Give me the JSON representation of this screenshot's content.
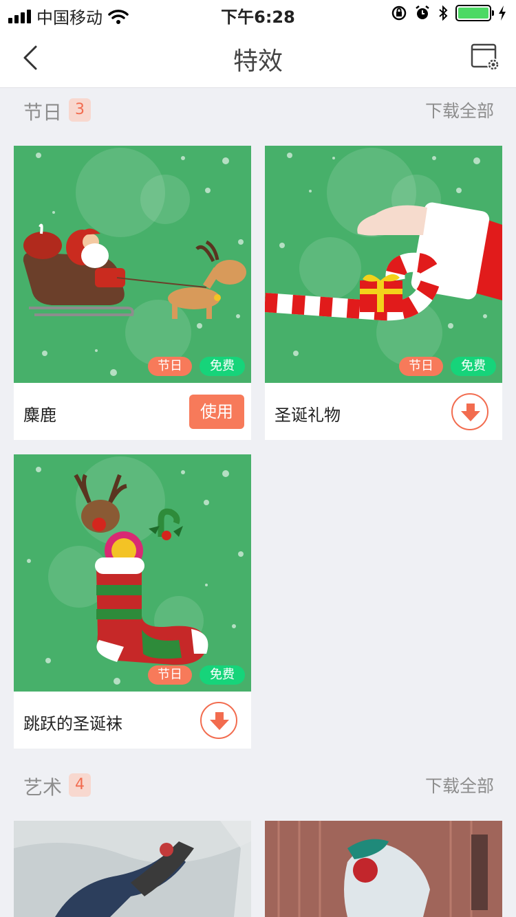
{
  "status_bar": {
    "carrier": "中国移动",
    "time": "下午6:28"
  },
  "nav": {
    "title": "特效"
  },
  "sections": [
    {
      "name": "节日",
      "count": "3",
      "download_all": "下载全部",
      "items": [
        {
          "name": "麋鹿",
          "tag1": "节日",
          "tag2": "免费",
          "action": "使用"
        },
        {
          "name": "圣诞礼物",
          "tag1": "节日",
          "tag2": "免费"
        },
        {
          "name": "跳跃的圣诞袜",
          "tag1": "节日",
          "tag2": "免费"
        }
      ]
    },
    {
      "name": "艺术",
      "count": "4",
      "download_all": "下载全部"
    }
  ],
  "colors": {
    "accent": "#f77a5a",
    "free_tag": "#16d47a",
    "card_bg": "#47b06a",
    "page_bg": "#eff0f4"
  }
}
